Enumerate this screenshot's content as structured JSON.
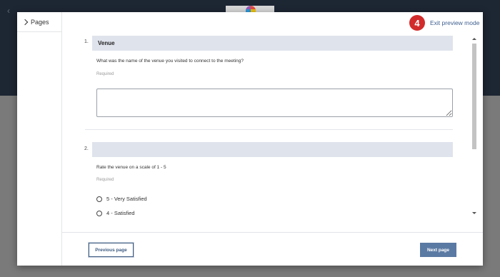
{
  "sidebar": {
    "title": "Pages"
  },
  "header": {
    "step_number": "4",
    "exit_label": "Exit preview mode"
  },
  "questions": [
    {
      "number": "1.",
      "title": "Venue",
      "text": "What was the name of the venue you visited to connect to the meeting?",
      "required_label": "Required",
      "answer_value": ""
    },
    {
      "number": "2.",
      "title": "",
      "text": "Rate the venue on a scale of 1 - 5",
      "required_label": "Required",
      "options": [
        "5 - Very Satisfied",
        "4 - Satisfied"
      ]
    }
  ],
  "footer": {
    "previous_label": "Previous page",
    "next_label": "Next page"
  },
  "colors": {
    "accent": "#3d5a80",
    "badge": "#d22b2b",
    "question_bar": "#dfe3ec"
  }
}
